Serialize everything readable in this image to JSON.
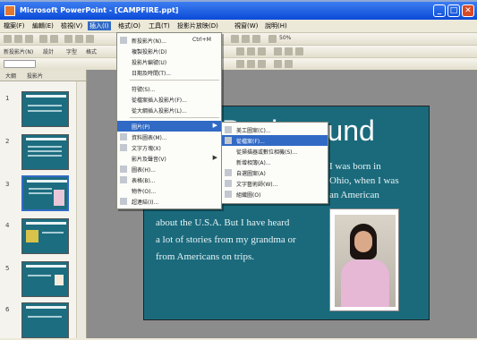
{
  "window": {
    "title": "Microsoft PowerPoint - [CAMPFIRE.ppt]",
    "min": "_",
    "max": "□",
    "close": "✕"
  },
  "menubar": {
    "items": [
      "檔案(F)",
      "編輯(E)",
      "檢視(V)",
      "插入(I)",
      "格式(O)",
      "工具(T)",
      "投影片放映(D)",
      "視窗(W)",
      "說明(H)"
    ],
    "selected_index": 3
  },
  "toolbar2": {
    "items": [
      "新投影片(N)",
      "設計",
      "字型",
      "格式"
    ]
  },
  "toolbar3": {
    "zoom": "50%"
  },
  "sidepane": {
    "tabs": [
      "大綱",
      "投影片"
    ],
    "slide_numbers": [
      "1",
      "2",
      "3",
      "4",
      "5",
      "6"
    ]
  },
  "slide": {
    "title": "Background",
    "body_lines": [
      "I was born in",
      "Ohio, when I was",
      "an American",
      "about the U.S.A. But I have heard",
      "a lot of stories from my grandma or",
      "from Americans on trips."
    ]
  },
  "insert_menu": {
    "items": [
      {
        "label": "新投影片(N)...",
        "shortcut": "Ctrl+M"
      },
      {
        "label": "複製投影片(D)"
      },
      {
        "label": "投影片編號(U)"
      },
      {
        "label": "日期及時間(T)..."
      },
      {
        "label": "符號(S)..."
      },
      {
        "label": "從檔案插入投影片(F)..."
      },
      {
        "label": "從大綱插入投影片(L)..."
      },
      {
        "label": "圖片(P)",
        "submenu": true
      },
      {
        "label": "資料圖表(M)..."
      },
      {
        "label": "文字方塊(X)"
      },
      {
        "label": "影片及聲音(V)",
        "submenu": true
      },
      {
        "label": "圖表(H)..."
      },
      {
        "label": "表格(B)..."
      },
      {
        "label": "物件(O)..."
      },
      {
        "label": "超連結(I)..."
      }
    ],
    "highlighted_index": 7
  },
  "picture_submenu": {
    "items": [
      "美工圖案(C)...",
      "從檔案(F)...",
      "從掃描器或數位相機(S)...",
      "新增相簿(A)...",
      "自選圖案(A)",
      "文字藝術師(W)...",
      "組織圖(O)"
    ],
    "highlighted_index": 1
  },
  "colors": {
    "slide_bg": "#1a6a7c",
    "menu_highlight": "#316ac5",
    "titlebar": "#0a4ad8"
  }
}
